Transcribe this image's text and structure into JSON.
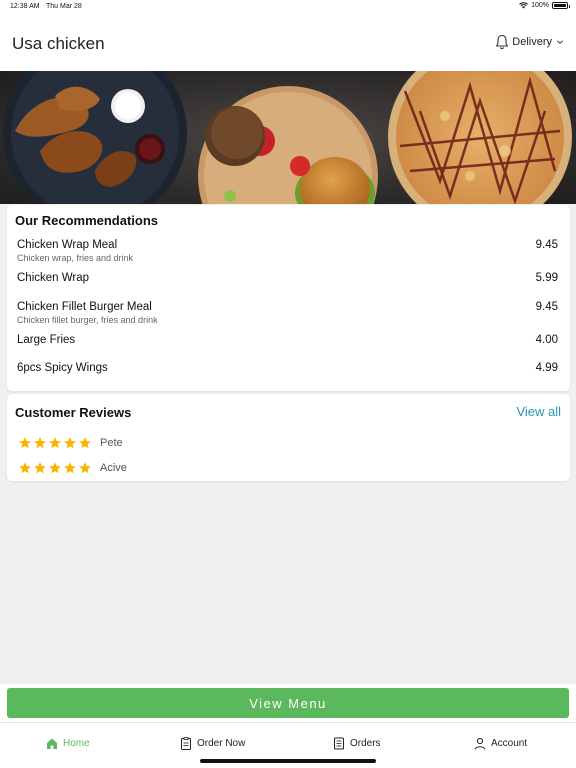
{
  "status_bar": {
    "time": "12:38 AM",
    "date": "Thu Mar 28",
    "battery": "100%"
  },
  "header": {
    "title": "Usa chicken",
    "bell_icon": "bell-icon",
    "delivery_label": "Delivery"
  },
  "recommendations": {
    "title": "Our Recommendations",
    "items": [
      {
        "name": "Chicken Wrap Meal",
        "description": "Chicken wrap, fries and drink",
        "price": "9.45"
      },
      {
        "name": "Chicken Wrap",
        "description": "",
        "price": "5.99"
      },
      {
        "name": "Chicken Fillet Burger Meal",
        "description": "Chicken fillet burger, fries and drink",
        "price": "9.45"
      },
      {
        "name": "Large Fries",
        "description": "",
        "price": "4.00"
      },
      {
        "name": "6pcs Spicy Wings",
        "description": "",
        "price": "4.99"
      }
    ]
  },
  "reviews": {
    "title": "Customer Reviews",
    "view_all": "View all",
    "items": [
      {
        "name": "Pete",
        "rating": 5
      },
      {
        "name": "Acive",
        "rating": 5
      }
    ]
  },
  "view_menu_label": "View Menu",
  "nav": {
    "items": [
      {
        "label": "Home",
        "icon": "home-icon",
        "active": true
      },
      {
        "label": "Order Now",
        "icon": "clipboard-icon",
        "active": false
      },
      {
        "label": "Orders",
        "icon": "receipt-icon",
        "active": false
      },
      {
        "label": "Account",
        "icon": "person-icon",
        "active": false
      }
    ]
  },
  "colors": {
    "accent_green": "#5cb85c",
    "link_blue": "#2a93b5",
    "star": "#f5b800"
  }
}
